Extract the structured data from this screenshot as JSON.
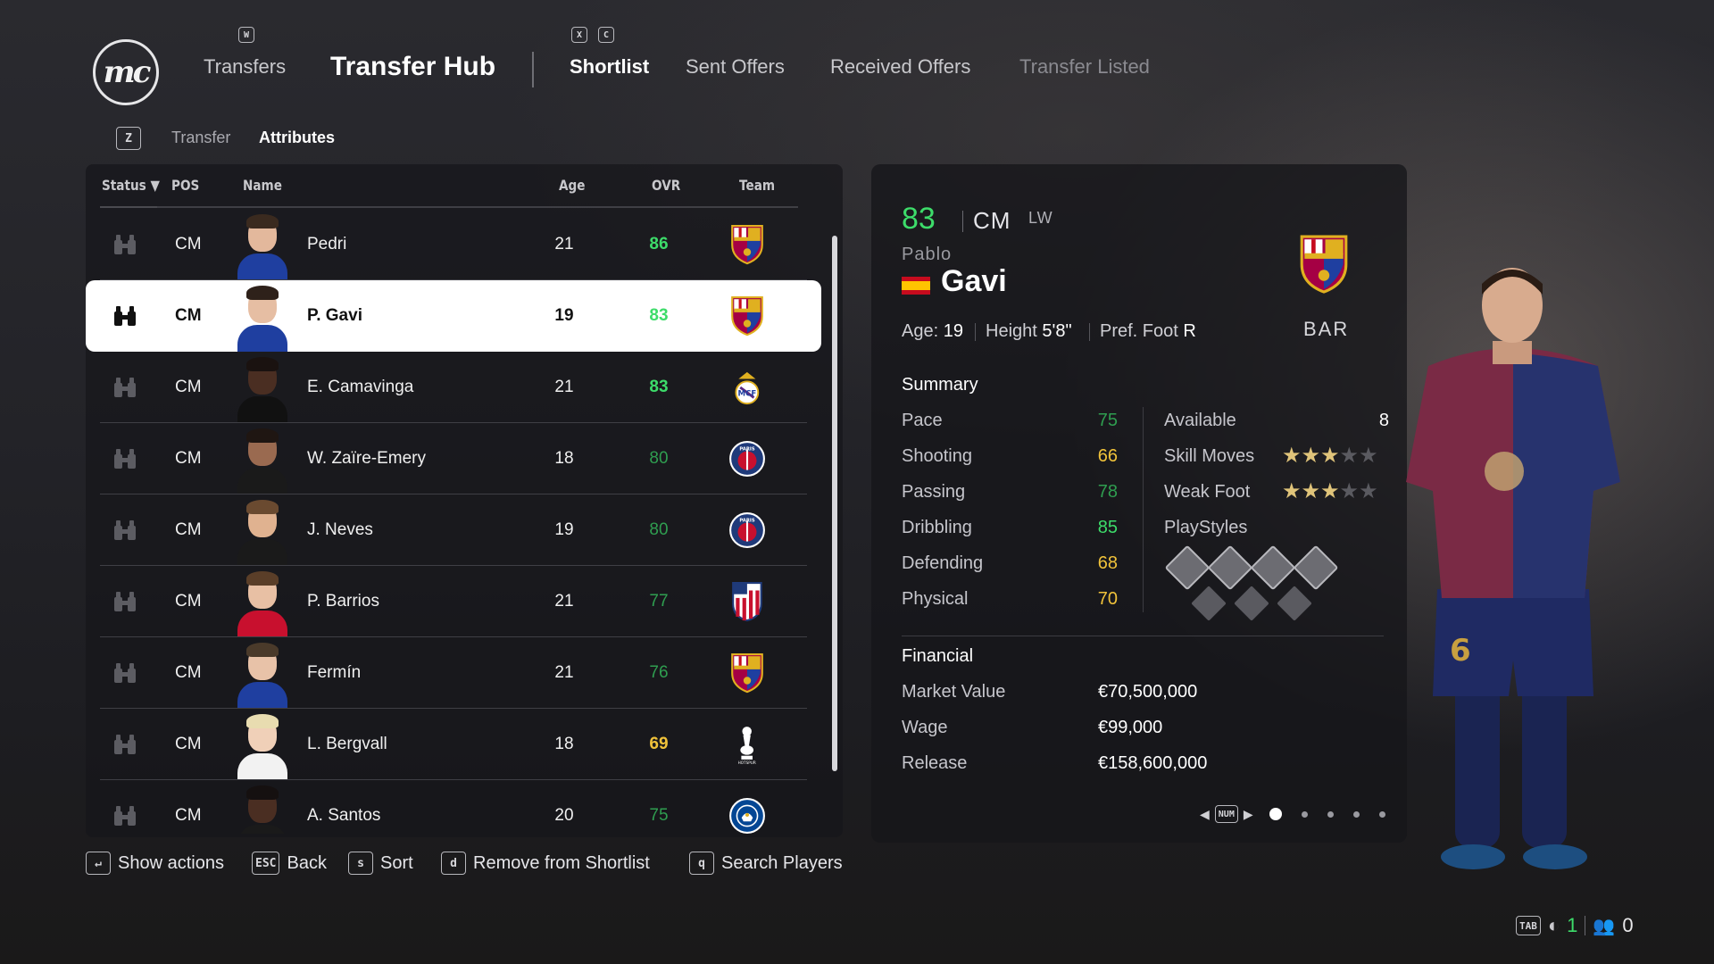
{
  "header": {
    "logo_text": "mc",
    "nav_transfers": "Transfers",
    "nav_title": "Transfer Hub",
    "key_w": "W",
    "key_x": "X",
    "key_c": "C",
    "tabs": [
      {
        "label": "Shortlist",
        "active": true
      },
      {
        "label": "Sent Offers",
        "active": false
      },
      {
        "label": "Received Offers",
        "active": false
      },
      {
        "label": "Transfer Listed",
        "active": false
      }
    ]
  },
  "subtabs": {
    "key": "Z",
    "items": [
      {
        "label": "Transfer",
        "active": false
      },
      {
        "label": "Attributes",
        "active": true
      }
    ]
  },
  "list": {
    "columns": {
      "status": "Status",
      "status_sort": "▼",
      "pos": "POS",
      "name": "Name",
      "age": "Age",
      "ovr": "OVR",
      "team": "Team"
    },
    "rows": [
      {
        "pos": "CM",
        "name": "Pedri",
        "age": "21",
        "ovr": "86",
        "ovr_tone": "g-bright",
        "team": "barcelona",
        "skin": "#e3b89c",
        "hair": "#3a2a1f",
        "shirt": "#1f3fa0"
      },
      {
        "pos": "CM",
        "name": "P. Gavi",
        "age": "19",
        "ovr": "83",
        "ovr_tone": "g-bright",
        "team": "barcelona",
        "skin": "#e6bea3",
        "hair": "#2e211a",
        "shirt": "#1f3fa0",
        "selected": true
      },
      {
        "pos": "CM",
        "name": "E. Camavinga",
        "age": "21",
        "ovr": "83",
        "ovr_tone": "g-bright",
        "team": "real-madrid",
        "skin": "#4a2e22",
        "hair": "#1a1210",
        "shirt": "#111111"
      },
      {
        "pos": "CM",
        "name": "W. Zaïre-Emery",
        "age": "18",
        "ovr": "80",
        "ovr_tone": "g-dim",
        "team": "psg",
        "skin": "#9a6a50",
        "hair": "#1f1612",
        "shirt": "#1a1a1a"
      },
      {
        "pos": "CM",
        "name": "J. Neves",
        "age": "19",
        "ovr": "80",
        "ovr_tone": "g-dim",
        "team": "psg",
        "skin": "#e0b290",
        "hair": "#6a4a30",
        "shirt": "#1a1a1a"
      },
      {
        "pos": "CM",
        "name": "P. Barrios",
        "age": "21",
        "ovr": "77",
        "ovr_tone": "g-dim",
        "team": "atletico",
        "skin": "#e8c0a4",
        "hair": "#5a3e28",
        "shirt": "#c8102e"
      },
      {
        "pos": "CM",
        "name": "Fermín",
        "age": "21",
        "ovr": "76",
        "ovr_tone": "g-dim",
        "team": "barcelona",
        "skin": "#e8c2a8",
        "hair": "#4a3a2a",
        "shirt": "#1f3fa0"
      },
      {
        "pos": "CM",
        "name": "L. Bergvall",
        "age": "18",
        "ovr": "69",
        "ovr_tone": "y",
        "team": "tottenham",
        "skin": "#f0d0b8",
        "hair": "#e8dcb0",
        "shirt": "#f2f2f2"
      },
      {
        "pos": "CM",
        "name": "A. Santos",
        "age": "20",
        "ovr": "75",
        "ovr_tone": "g-dim",
        "team": "chelsea",
        "skin": "#4a2e22",
        "hair": "#151010",
        "shirt": "#1a1a1a"
      }
    ]
  },
  "detail": {
    "ovr": "83",
    "position": "CM",
    "alt_position": "LW",
    "first_name": "Pablo",
    "last_name": "Gavi",
    "nationality_flag": "spain-flag",
    "age_label": "Age:",
    "age": "19",
    "height_label": "Height",
    "height": "5'8\"",
    "foot_label": "Pref. Foot",
    "foot": "R",
    "team_abbr": "BAR",
    "summary_title": "Summary",
    "stats": [
      {
        "label": "Pace",
        "value": "75",
        "tone": "v-gd"
      },
      {
        "label": "Shooting",
        "value": "66",
        "tone": "v-y"
      },
      {
        "label": "Passing",
        "value": "78",
        "tone": "v-gd"
      },
      {
        "label": "Dribbling",
        "value": "85",
        "tone": "v-g"
      },
      {
        "label": "Defending",
        "value": "68",
        "tone": "v-y"
      },
      {
        "label": "Physical",
        "value": "70",
        "tone": "v-y"
      }
    ],
    "available_label": "Available",
    "available_value": "8",
    "skill_moves_label": "Skill Moves",
    "skill_moves_stars": 3,
    "weak_foot_label": "Weak Foot",
    "weak_foot_stars": 3,
    "playstyles_label": "PlayStyles",
    "financial_title": "Financial",
    "financial": [
      {
        "label": "Market Value",
        "value": "€70,500,000"
      },
      {
        "label": "Wage",
        "value": "€99,000"
      },
      {
        "label": "Release",
        "value": "€158,600,000"
      }
    ],
    "pager_key": "NUM",
    "pager_pages": 5,
    "pager_current": 1
  },
  "footer": {
    "actions": [
      {
        "key": "↵",
        "label": "Show actions"
      },
      {
        "key": "ESC",
        "label": "Back"
      },
      {
        "key": "s",
        "label": "Sort"
      },
      {
        "key": "d",
        "label": "Remove from Shortlist"
      },
      {
        "key": "q",
        "label": "Search Players"
      }
    ],
    "tab_key": "TAB",
    "online_count": "1",
    "friends_count": "0"
  },
  "colors": {
    "green_bright": "#3ddc6a",
    "green_dim": "#2f9e50",
    "yellow": "#f0c23a"
  }
}
